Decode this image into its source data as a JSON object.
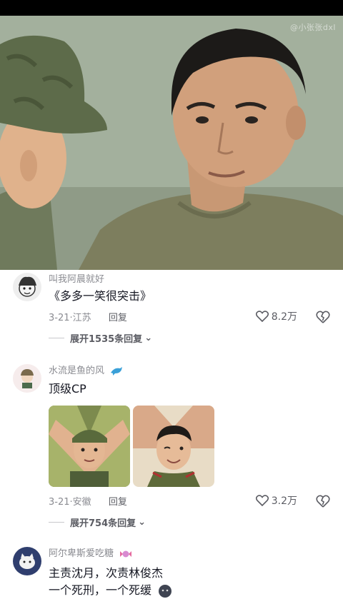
{
  "video": {
    "watermark": "@小张张dxl"
  },
  "comments": [
    {
      "username": "叫我阿晨就好",
      "text": "《多多一笑很突击》",
      "date": "3-21",
      "location": "江苏",
      "reply_label": "回复",
      "likes": "8.2万",
      "expand_label": "展开1535条回复"
    },
    {
      "username": "水流是鱼的风",
      "text": "顶级CP",
      "date": "3-21",
      "location": "安徽",
      "reply_label": "回复",
      "likes": "3.2万",
      "expand_label": "展开754条回复"
    },
    {
      "username": "阿尔卑斯爱吃糖",
      "text_line1": "主责沈月，次责林俊杰",
      "text_line2": "一个死刑，一个死缓"
    }
  ],
  "colors": {
    "meta": "#8a8b91",
    "text": "#161823"
  }
}
